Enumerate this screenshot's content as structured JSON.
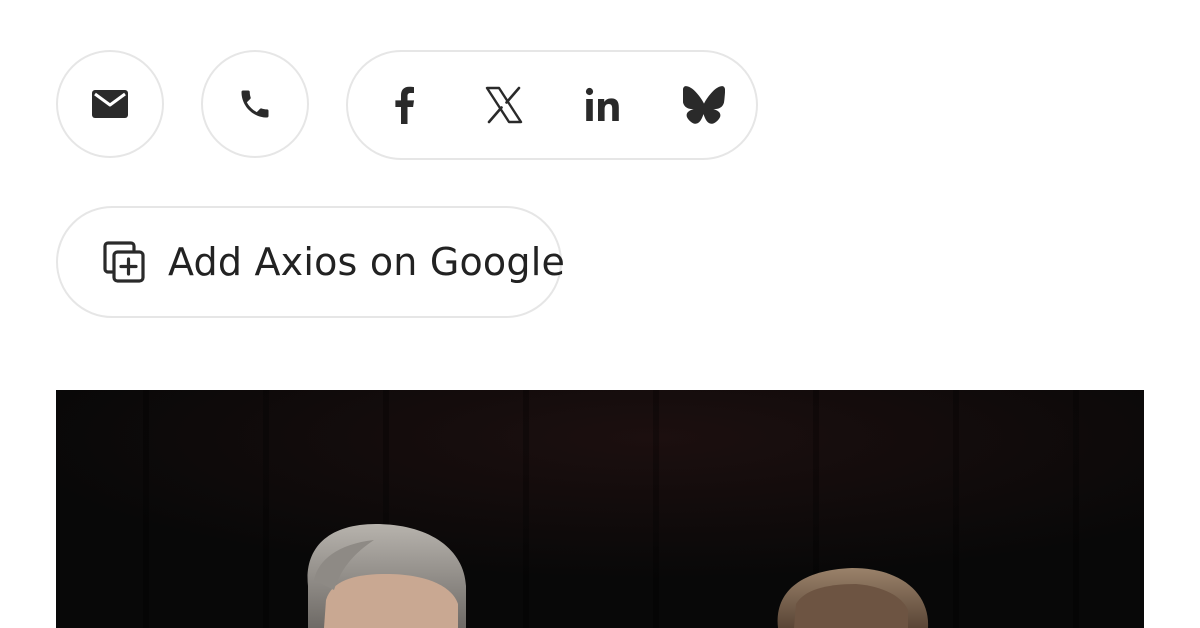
{
  "share": {
    "email_icon": "email-icon",
    "phone_icon": "phone-icon",
    "social": [
      {
        "name": "facebook",
        "icon": "facebook-icon"
      },
      {
        "name": "x",
        "icon": "x-icon"
      },
      {
        "name": "linkedin",
        "icon": "linkedin-icon"
      },
      {
        "name": "bluesky",
        "icon": "bluesky-icon"
      }
    ]
  },
  "google_button": {
    "label": "Add Axios on Google",
    "icon": "add-copy-icon"
  },
  "colors": {
    "icon": "#2a2a2a",
    "border": "#e6e6e6",
    "photo_background": "#0b0b0b"
  }
}
